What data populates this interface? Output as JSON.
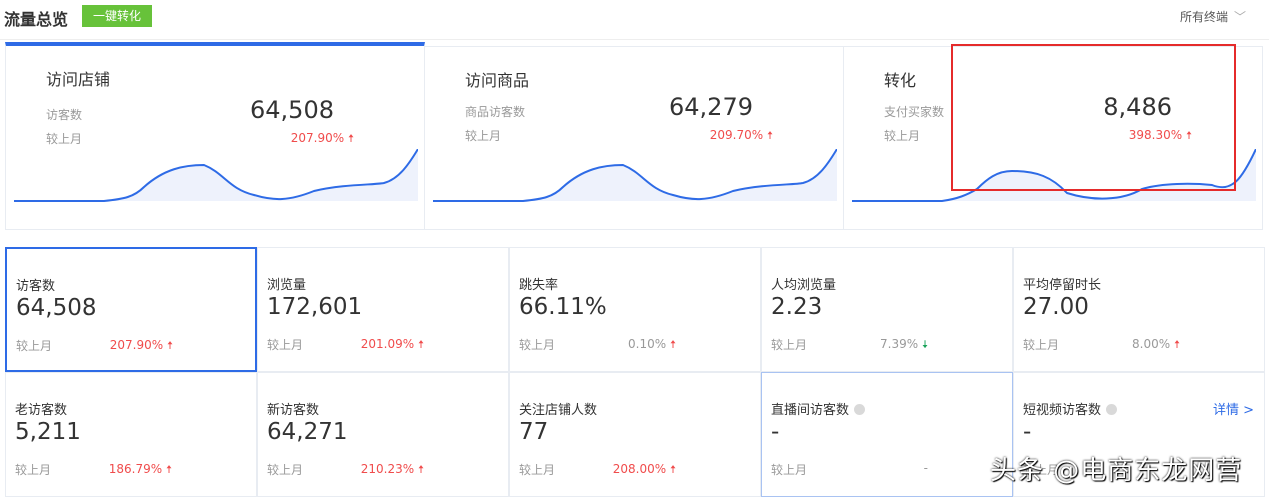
{
  "header": {
    "title": "流量总览",
    "convert_button": "一键转化",
    "terminal_select": "所有终端"
  },
  "cards": [
    {
      "title": "访问店铺",
      "label": "访客数",
      "value": "64,508",
      "compare": "较上月",
      "pct": "207.90%"
    },
    {
      "title": "访问商品",
      "label": "商品访客数",
      "value": "64,279",
      "compare": "较上月",
      "pct": "209.70%"
    },
    {
      "title": "转化",
      "label": "支付买家数",
      "value": "8,486",
      "compare": "较上月",
      "pct": "398.30%"
    }
  ],
  "metrics": [
    {
      "label": "访客数",
      "value": "64,508",
      "compare": "较上月",
      "pct": "207.90%",
      "trend": "up"
    },
    {
      "label": "浏览量",
      "value": "172,601",
      "compare": "较上月",
      "pct": "201.09%",
      "trend": "up"
    },
    {
      "label": "跳失率",
      "value": "66.11%",
      "compare": "较上月",
      "pct": "0.10%",
      "trend": "up"
    },
    {
      "label": "人均浏览量",
      "value": "2.23",
      "compare": "较上月",
      "pct": "7.39%",
      "trend": "down"
    },
    {
      "label": "平均停留时长",
      "value": "27.00",
      "compare": "较上月",
      "pct": "8.00%",
      "trend": "up"
    },
    {
      "label": "老访客数",
      "value": "5,211",
      "compare": "较上月",
      "pct": "186.79%",
      "trend": "up"
    },
    {
      "label": "新访客数",
      "value": "64,271",
      "compare": "较上月",
      "pct": "210.23%",
      "trend": "up"
    },
    {
      "label": "关注店铺人数",
      "value": "77",
      "compare": "较上月",
      "pct": "208.00%",
      "trend": "up"
    },
    {
      "label": "直播间访客数",
      "value": "-",
      "compare": "较上月",
      "pct": "-"
    },
    {
      "label": "短视频访客数",
      "value": "-",
      "compare": "较上月",
      "pct": "",
      "detail": "详情 >"
    }
  ],
  "arrows": {
    "up": "🠅",
    "down": "🠇"
  },
  "watermark": "头条 @电商东龙网营"
}
